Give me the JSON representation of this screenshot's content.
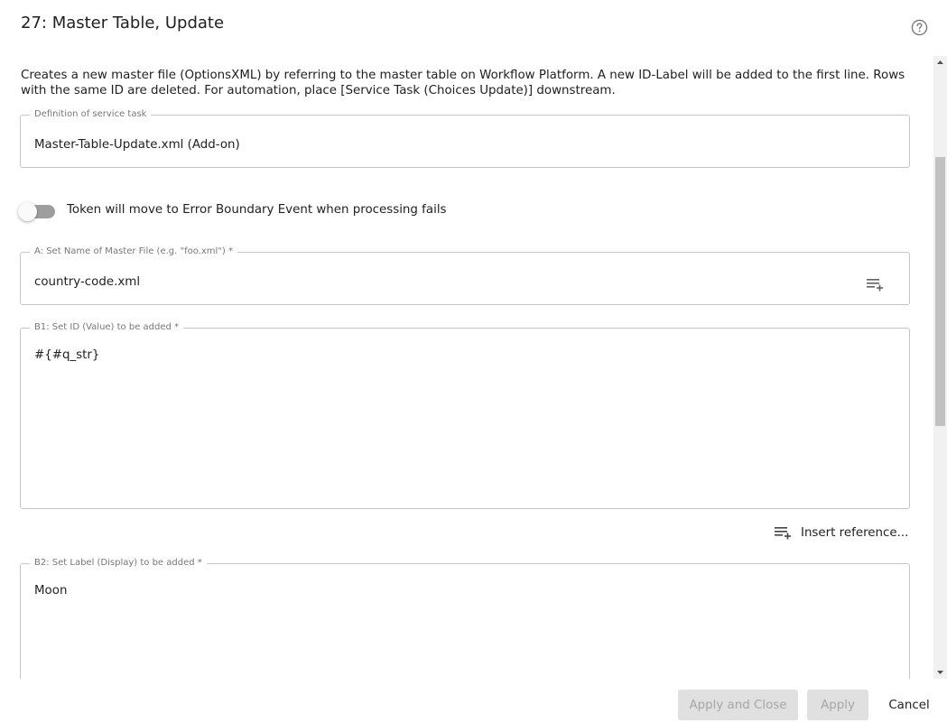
{
  "dialog": {
    "title": "27: Master Table, Update",
    "help_icon": "help-circle-icon"
  },
  "description": "Creates a new master file (OptionsXML) by referring to the master table on Workflow Platform. A new ID-Label will be added to the first line. Rows with the same ID are deleted. For automation, place [Service Task (Choices Update)] downstream.",
  "definition": {
    "legend": "Definition of service task",
    "value": "Master-Table-Update.xml (Add-on)"
  },
  "error_toggle": {
    "label": "Token will move to Error Boundary Event when processing fails",
    "on": false
  },
  "master_file": {
    "legend": "A: Set Name of Master File (e.g. \"foo.xml\") *",
    "value": "country-code.xml",
    "icon": "insert-reference-icon"
  },
  "id_field": {
    "legend": "B1: Set ID (Value) to be added *",
    "value": "#{#q_str}"
  },
  "insert_reference": {
    "label": "Insert reference...",
    "icon": "insert-reference-icon"
  },
  "label_field": {
    "legend": "B2: Set Label (Display) to be added *",
    "value": "Moon"
  },
  "footer": {
    "apply_close_label": "Apply and Close",
    "apply_label": "Apply",
    "cancel_label": "Cancel"
  },
  "colors": {
    "text": "#212121",
    "border": "#c6c6c6",
    "legend": "#777777",
    "disabled_bg": "#e0e0e0",
    "disabled_text": "#a6a6a6",
    "toggle_track": "#9e9e9e"
  }
}
